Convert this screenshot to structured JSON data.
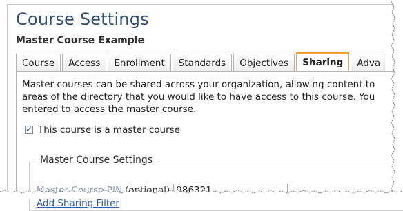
{
  "header": {
    "title": "Course Settings",
    "subtitle": "Master Course Example"
  },
  "tabs": [
    {
      "label": "Course",
      "active": false
    },
    {
      "label": "Access",
      "active": false
    },
    {
      "label": "Enrollment",
      "active": false
    },
    {
      "label": "Standards",
      "active": false
    },
    {
      "label": "Objectives",
      "active": false
    },
    {
      "label": "Sharing",
      "active": true
    },
    {
      "label": "Adva",
      "active": false
    }
  ],
  "sharing": {
    "description_lines": [
      "Master courses can be shared across your organization, allowing content to",
      "areas of the directory that you would like to have access to this course. You",
      "entered to access the master course."
    ],
    "master_checkbox": {
      "label": "This course is a master course",
      "checked": true
    },
    "settings_group": {
      "legend": "Master Course Settings",
      "pin_label": "Master Course PIN",
      "pin_optional": "(optional)",
      "pin_value": "986321",
      "add_filter_link": "Add Sharing Filter"
    }
  },
  "colors": {
    "title": "#2f4f74",
    "active_tab_border": "#f0a22e",
    "link": "#2a5db0",
    "muted_label": "#8a9cb8"
  }
}
